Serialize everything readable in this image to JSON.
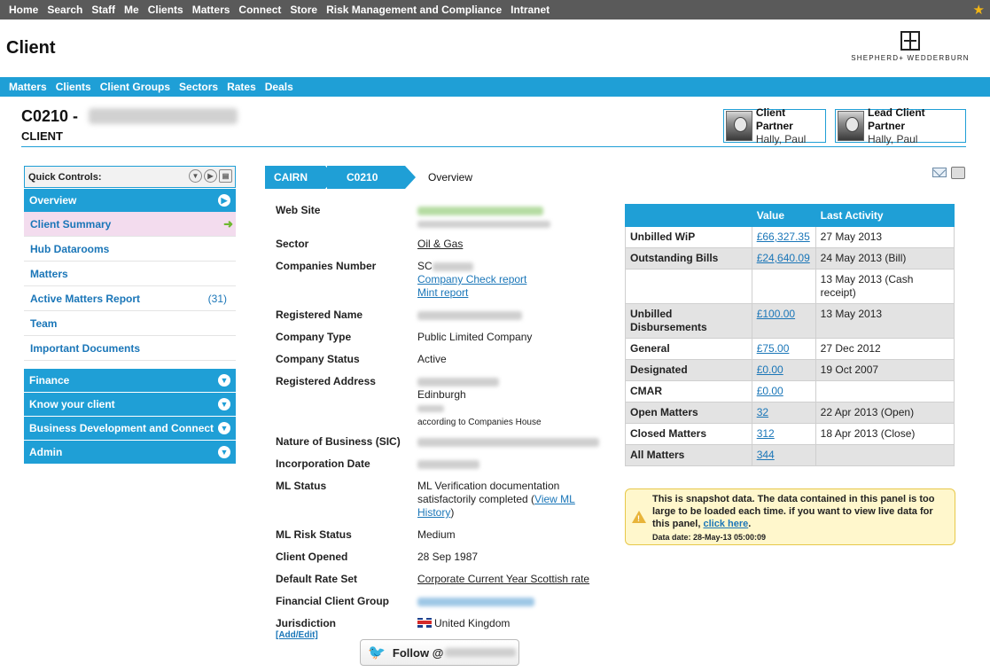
{
  "topnav": {
    "items": [
      "Home",
      "Search",
      "Staff",
      "Me",
      "Clients",
      "Matters",
      "Connect",
      "Store",
      "Risk Management and Compliance",
      "Intranet"
    ]
  },
  "header": {
    "title": "Client",
    "logo_text": "SHEPHERD+ WEDDERBURN"
  },
  "subnav": {
    "items": [
      "Matters",
      "Clients",
      "Client Groups",
      "Sectors",
      "Rates",
      "Deals"
    ]
  },
  "client": {
    "code": "C0210 -",
    "type": "CLIENT"
  },
  "partners": [
    {
      "role": "Client Partner",
      "name": "Hally, Paul"
    },
    {
      "role": "Lead Client Partner",
      "name": "Hally, Paul"
    }
  ],
  "quick_controls": {
    "title": "Quick Controls:",
    "overview": "Overview",
    "items": [
      {
        "label": "Client Summary",
        "active": true
      },
      {
        "label": "Hub Datarooms"
      },
      {
        "label": "Matters"
      },
      {
        "label": "Active Matters Report",
        "count": "(31)"
      },
      {
        "label": "Team"
      },
      {
        "label": "Important Documents"
      }
    ],
    "sections": [
      "Finance",
      "Know your client",
      "Business Development and Connect",
      "Admin"
    ]
  },
  "breadcrumb": {
    "items": [
      "CAIRN",
      "C0210"
    ],
    "current": "Overview"
  },
  "details": {
    "website": "Web Site",
    "sector": "Sector",
    "sector_value": "Oil & Gas",
    "companies_number": "Companies Number",
    "companies_number_value": "SC",
    "company_check": "Company Check report",
    "mint_report": "Mint report",
    "registered_name": "Registered Name",
    "company_type": "Company Type",
    "company_type_value": "Public Limited Company",
    "company_status": "Company Status",
    "company_status_value": "Active",
    "registered_address": "Registered Address",
    "address_city": "Edinburgh",
    "address_note": "according to Companies House",
    "nature_of_business": "Nature of Business (SIC)",
    "incorporation_date": "Incorporation Date",
    "ml_status": "ML Status",
    "ml_status_value": "ML Verification documentation satisfactorily completed (",
    "ml_history": "View ML History",
    "ml_status_close": ")",
    "ml_risk_status": "ML Risk Status",
    "ml_risk_status_value": "Medium",
    "client_opened": "Client Opened",
    "client_opened_value": "28 Sep 1987",
    "default_rate_set": "Default Rate Set",
    "default_rate_set_value": "Corporate Current Year Scottish rate",
    "financial_client_group": "Financial Client Group",
    "jurisdiction": "Jurisdiction",
    "jurisdiction_value": "United Kingdom",
    "add_edit": "[Add/Edit]"
  },
  "follow": {
    "label": "Follow @"
  },
  "finance": {
    "headers": [
      "",
      "Value",
      "Last Activity"
    ],
    "rows": [
      {
        "name": "Unbilled WiP",
        "value": "£66,327.35",
        "activity": "27 May 2013"
      },
      {
        "name": "Outstanding Bills",
        "value": "£24,640.09",
        "activity": "24 May 2013 (Bill)"
      },
      {
        "name": "",
        "value": "",
        "activity": "13 May 2013 (Cash receipt)"
      },
      {
        "name": "Unbilled Disbursements",
        "value": "£100.00",
        "activity": "13 May 2013"
      },
      {
        "name": "General",
        "value": "£75.00",
        "activity": "27 Dec 2012"
      },
      {
        "name": "Designated",
        "value": "£0.00",
        "activity": "19 Oct 2007"
      },
      {
        "name": "CMAR",
        "value": "£0.00",
        "activity": ""
      },
      {
        "name": "Open Matters",
        "value": "32",
        "activity": "22 Apr 2013 (Open)"
      },
      {
        "name": "Closed Matters",
        "value": "312",
        "activity": "18 Apr 2013 (Close)"
      },
      {
        "name": "All Matters",
        "value": "344",
        "activity": ""
      }
    ]
  },
  "snapshot": {
    "text": "This is snapshot data. The data contained in this panel is too large to be loaded each time. if you want to view live data for this panel, ",
    "link": "click here",
    "end": ".",
    "date": "Data date: 28-May-13 05:00:09"
  }
}
